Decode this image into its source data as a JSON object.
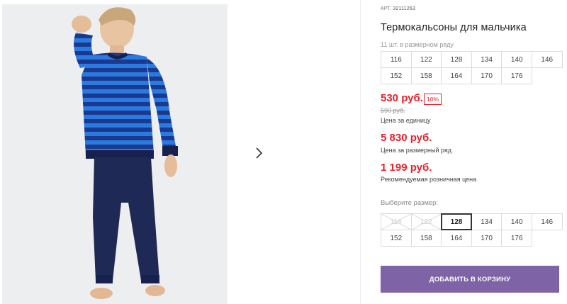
{
  "product": {
    "article_label": "АРТ.",
    "article": "32111263",
    "title": "Термокальсоны для мальчика",
    "size_note": "11 шт. в размерном ряду"
  },
  "size_range": [
    "116",
    "122",
    "128",
    "134",
    "140",
    "146",
    "152",
    "158",
    "164",
    "170",
    "176"
  ],
  "prices": {
    "unit_price": "530 руб.",
    "discount": "10%",
    "old_price": "590 руб.",
    "unit_caption": "Цена за единицу",
    "row_price": "5 830 руб.",
    "row_caption": "Цена за размерный ряд",
    "rrp_price": "1 199 руб.",
    "rrp_caption": "Рекомендуемая розничная цена"
  },
  "size_select": {
    "label": "Выберите размер:",
    "selected": "128",
    "unavailable": [
      "116",
      "122"
    ]
  },
  "cart": {
    "label": "ДОБАВИТЬ В КОРЗИНУ"
  },
  "gallery": {
    "next_icon": "chevron-right-icon"
  },
  "colors": {
    "price": "#e4232e",
    "button": "#7e63a6"
  }
}
